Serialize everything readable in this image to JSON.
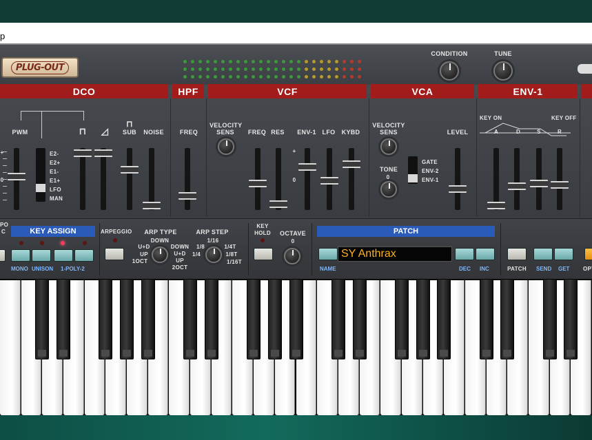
{
  "window": {
    "title_fragment": "p"
  },
  "header": {
    "logo": "PLUG-OUT",
    "knobs": [
      {
        "label": "CONDITION"
      },
      {
        "label": "TUNE"
      }
    ]
  },
  "sections": {
    "dco": "DCO",
    "hpf": "HPF",
    "vcf": "VCF",
    "vca": "VCA",
    "env1": "ENV-1"
  },
  "dco": {
    "pwm": "PWM",
    "square": "⊓",
    "saw": "◿",
    "sub": "SUB",
    "sub_icon": "⊓",
    "noise": "NOISE",
    "mod_sources": [
      "E2-",
      "E2+",
      "E1-",
      "E1+",
      "LFO",
      "MAN"
    ],
    "scale_labels": [
      "+",
      "0"
    ]
  },
  "hpf": {
    "freq": "FREQ"
  },
  "vcf": {
    "velocity": "VELOCITY",
    "sens": "SENS",
    "freq": "FREQ",
    "res": "RES",
    "env1": "ENV-1",
    "lfo": "LFO",
    "kybd": "KYBD",
    "plus": "+",
    "zero": "0"
  },
  "vca": {
    "velocity": "VELOCITY",
    "sens": "SENS",
    "tone": "TONE",
    "tone_zero": "0",
    "level": "LEVEL",
    "env_sources": [
      "GATE",
      "ENV-2",
      "ENV-1"
    ]
  },
  "env1": {
    "key_on": "KEY ON",
    "key_off": "KEY OFF",
    "stages": [
      "A",
      "D",
      "S",
      "R"
    ]
  },
  "lower": {
    "po_frag": "PO",
    "c_frag": "C",
    "key_assign": "KEY ASSIGN",
    "key_assign_labels": [
      "MONO",
      "UNISON",
      "1-POLY-2"
    ],
    "arpeggio": "ARPEGGIO",
    "arp_type": "ARP TYPE",
    "arp_type_opts": {
      "down_top": "DOWN",
      "ud_left": "U+D",
      "up_left": "UP",
      "oct1": "1OCT",
      "down_right": "DOWN",
      "ud_right": "U+D",
      "up_right": "UP",
      "oct2": "2OCT"
    },
    "arp_step": "ARP STEP",
    "arp_step_opts": {
      "s16": "1/16",
      "s8": "1/8",
      "s4": "1/4",
      "t4": "1/4T",
      "t8": "1/8T",
      "t16": "1/16T"
    },
    "key_hold": [
      "KEY",
      "HOLD"
    ],
    "octave": "OCTAVE",
    "octave_zero": "0",
    "patch": "PATCH",
    "patch_name": "SY Anthrax",
    "name": "NAME",
    "dec": "DEC",
    "inc": "INC",
    "patch_btn": "PATCH",
    "send": "SEND",
    "get": "GET",
    "opt_frag": "OPT"
  },
  "colors": {
    "section_red": "#a31c1c",
    "patch_blue": "#2a5bb8",
    "lcd_text": "#ffb21a",
    "led_red": "#ff3b5a"
  },
  "keyboard": {
    "white_keys": 28,
    "black_pattern": "standard"
  }
}
